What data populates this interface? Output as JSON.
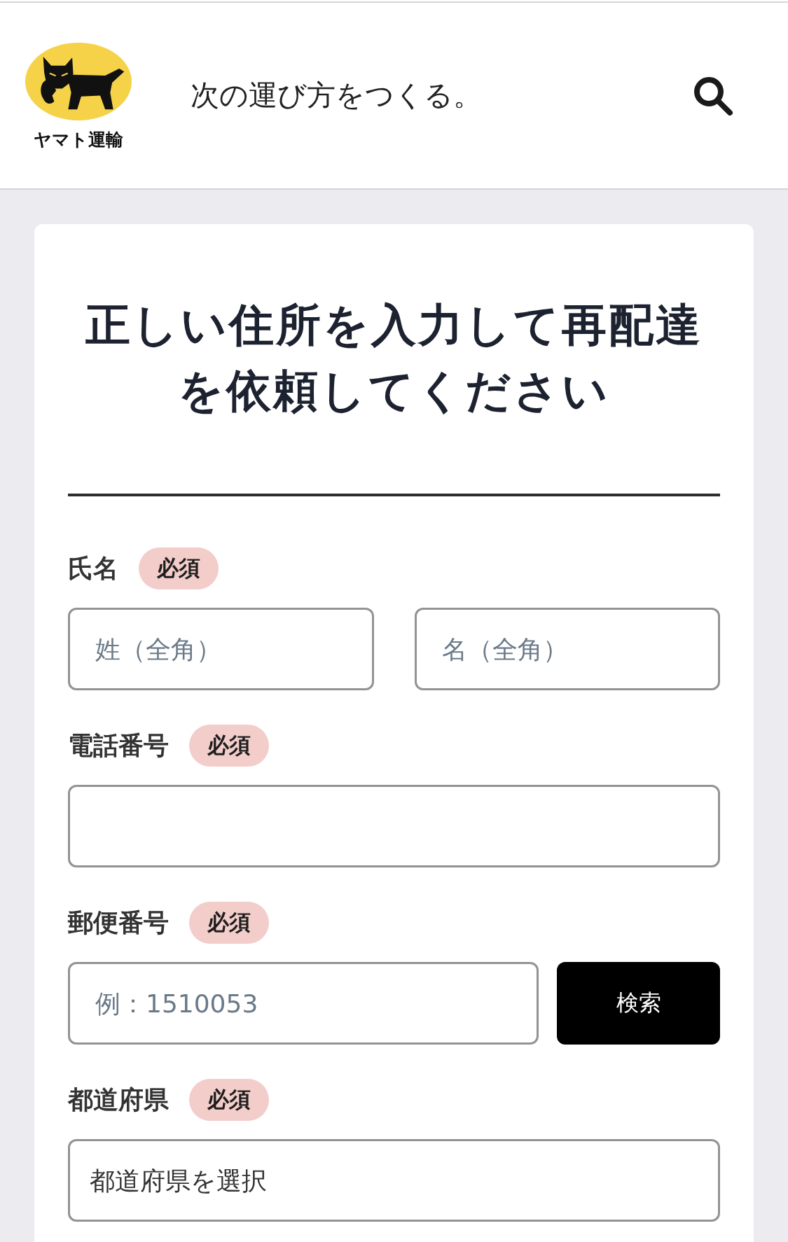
{
  "header": {
    "brand": "ヤマト運輸",
    "tagline": "次の運び方をつくる。"
  },
  "form": {
    "title": "正しい住所を入力して再配達を依頼してください",
    "fields": [
      {
        "kind": "pair",
        "label": "氏名",
        "badge": "必須",
        "placeholders": [
          "姓（全角）",
          "名（全角）"
        ]
      },
      {
        "kind": "text",
        "label": "電話番号",
        "badge": "必須"
      },
      {
        "kind": "search",
        "label": "郵便番号",
        "badge": "必須",
        "placeholder": "例：1510053",
        "button": "検索"
      },
      {
        "kind": "select",
        "label": "都道府県",
        "badge": "必須",
        "value": "都道府県を選択"
      }
    ]
  }
}
